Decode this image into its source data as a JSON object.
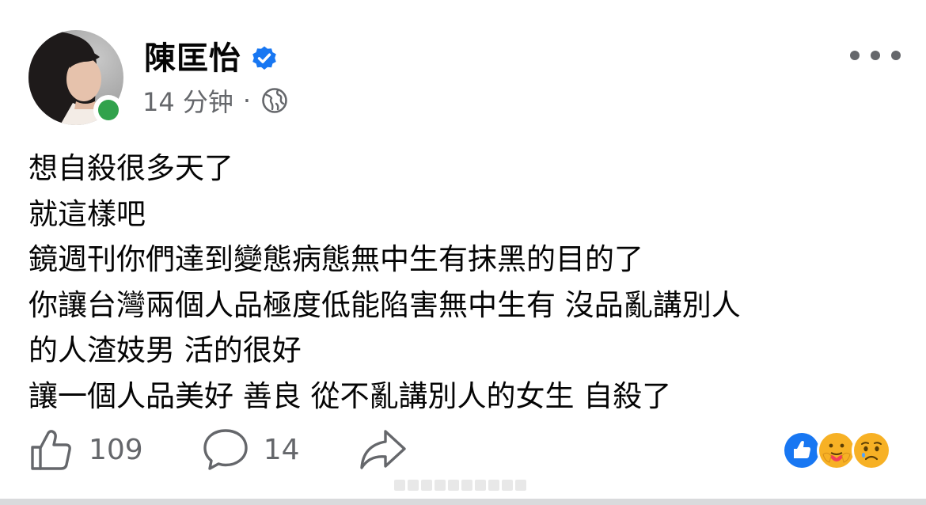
{
  "post": {
    "author": "陳匡怡",
    "verified": true,
    "time": "14 分钟",
    "separator": "·",
    "audience_icon": "globe-icon",
    "more_icon": "more-horizontal-icon",
    "lines": [
      "想自殺很多天了",
      "就這樣吧",
      "鏡週刊你們達到變態病態無中生有抹黑的目的了",
      "你讓台灣兩個人品極度低能陷害無中生有 沒品亂講別人",
      "的人渣妓男 活的很好",
      "讓一個人品美好 善良 從不亂講別人的女生 自殺了"
    ]
  },
  "actions": {
    "likes": "109",
    "comments": "14",
    "like_icon": "thumbs-up-icon",
    "comment_icon": "comment-bubble-icon",
    "share_icon": "share-arrow-icon"
  },
  "reactions": [
    "like-reaction-icon",
    "care-reaction-icon",
    "sad-reaction-icon"
  ],
  "colors": {
    "text": "#050505",
    "secondary": "#65676b",
    "verified_blue": "#1877f2",
    "online_green": "#31a24c"
  }
}
